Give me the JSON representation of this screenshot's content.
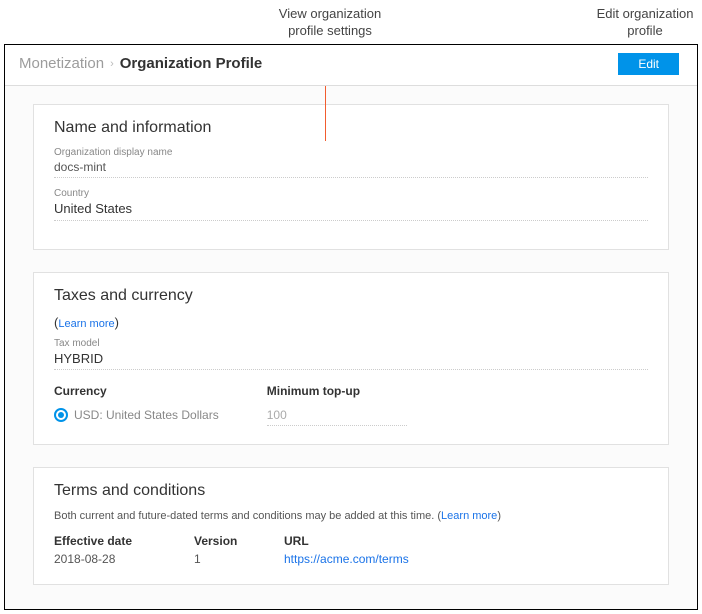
{
  "callouts": {
    "view_l1": "View organization",
    "view_l2": "profile settings",
    "edit_l1": "Edit organization",
    "edit_l2": "profile"
  },
  "breadcrumb": {
    "root": "Monetization",
    "current": "Organization Profile"
  },
  "buttons": {
    "edit": "Edit"
  },
  "sections": {
    "name": {
      "title": "Name and information",
      "display_name_label": "Organization display name",
      "display_name_value": "docs-mint",
      "country_label": "Country",
      "country_value": "United States"
    },
    "taxes": {
      "title": "Taxes and currency",
      "learn_more": "Learn more",
      "tax_model_label": "Tax model",
      "tax_model_value": "HYBRID",
      "currency_header": "Currency",
      "currency_option": "USD: United States Dollars",
      "topup_header": "Minimum top-up",
      "topup_value": "100"
    },
    "terms": {
      "title": "Terms and conditions",
      "desc_prefix": "Both current and future-dated terms and conditions may be added at this time. (",
      "desc_suffix": ")",
      "learn_more": "Learn more",
      "col_date": "Effective date",
      "col_version": "Version",
      "col_url": "URL",
      "rows": [
        {
          "date": "2018-08-28",
          "version": "1",
          "url": "https://acme.com/terms"
        }
      ]
    }
  }
}
